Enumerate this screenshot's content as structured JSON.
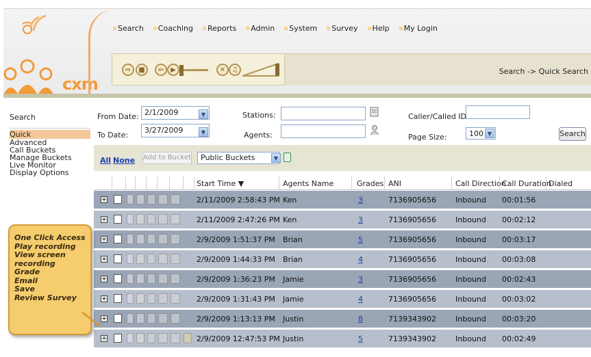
{
  "logo": {
    "text": "cxm"
  },
  "menu": [
    {
      "label": "Search"
    },
    {
      "label": "Coaching"
    },
    {
      "label": "Reports"
    },
    {
      "label": "Admin"
    },
    {
      "label": "System"
    },
    {
      "label": "Survey"
    },
    {
      "label": "Help"
    },
    {
      "label": "My Login"
    }
  ],
  "breadcrumb": "Search  ->  Quick Search",
  "sidebar": {
    "heading": "Search",
    "items": [
      {
        "label": "Quick",
        "active": true
      },
      {
        "label": "Advanced"
      },
      {
        "label": "Call Buckets"
      },
      {
        "label": "Manage Buckets"
      },
      {
        "label": "Live Monitor"
      },
      {
        "label": "Display Options"
      }
    ]
  },
  "filters": {
    "from_label": "From Date:",
    "from_value": "2/1/2009",
    "to_label": "To Date:",
    "to_value": "3/27/2009",
    "stations_label": "Stations:",
    "agents_label": "Agents:",
    "caller_label": "Caller/Called ID:",
    "page_size_label": "Page Size:",
    "page_size_value": "100",
    "search_button": "Search"
  },
  "buckets": {
    "all": "All",
    "none": "None",
    "add_button": "Add to Bucket",
    "select_value": "Public Buckets"
  },
  "table": {
    "columns": [
      "Start Time ▼",
      "Agents Name",
      "Grades",
      "ANI",
      "Call Direction",
      "Call Duration",
      "Dialed"
    ],
    "rows": [
      {
        "start": "2/11/2009 2:58:43 PM",
        "agent": "Ken",
        "grade": "3",
        "ani": "7136905656",
        "direction": "Inbound",
        "duration": "00:01:56"
      },
      {
        "start": "2/11/2009 2:47:26 PM",
        "agent": "Ken",
        "grade": "3",
        "ani": "7136905656",
        "direction": "Inbound",
        "duration": "00:02:12"
      },
      {
        "start": "2/9/2009 1:51:37 PM",
        "agent": "Brian",
        "grade": "5",
        "ani": "7136905656",
        "direction": "Inbound",
        "duration": "00:03:17"
      },
      {
        "start": "2/9/2009 1:44:33 PM",
        "agent": "Brian",
        "grade": "4",
        "ani": "7136905656",
        "direction": "Inbound",
        "duration": "00:03:08"
      },
      {
        "start": "2/9/2009 1:36:23 PM",
        "agent": "Jamie",
        "grade": "3",
        "ani": "7136905656",
        "direction": "Inbound",
        "duration": "00:02:43"
      },
      {
        "start": "2/9/2009 1:31:43 PM",
        "agent": "Jamie",
        "grade": "4",
        "ani": "7136905656",
        "direction": "Inbound",
        "duration": "00:03:02"
      },
      {
        "start": "2/9/2009 1:13:13 PM",
        "agent": "Justin",
        "grade": "8",
        "ani": "7139343902",
        "direction": "Inbound",
        "duration": "00:03:20"
      },
      {
        "start": "2/9/2009 12:47:53 PM",
        "agent": "Justin",
        "grade": "5",
        "ani": "7139343902",
        "direction": "Inbound",
        "duration": "00:02:49"
      }
    ]
  },
  "callout": {
    "lines": [
      "One Click Access",
      "Play recording",
      "View screen",
      "recording",
      "Grade",
      "Email",
      "Save",
      "Review Survey"
    ]
  },
  "colors": {
    "accent_orange": "#f29a3a",
    "row_dark": "#9aa5b5",
    "row_light": "#b6bfcb",
    "link_blue": "#1b3fb0"
  }
}
